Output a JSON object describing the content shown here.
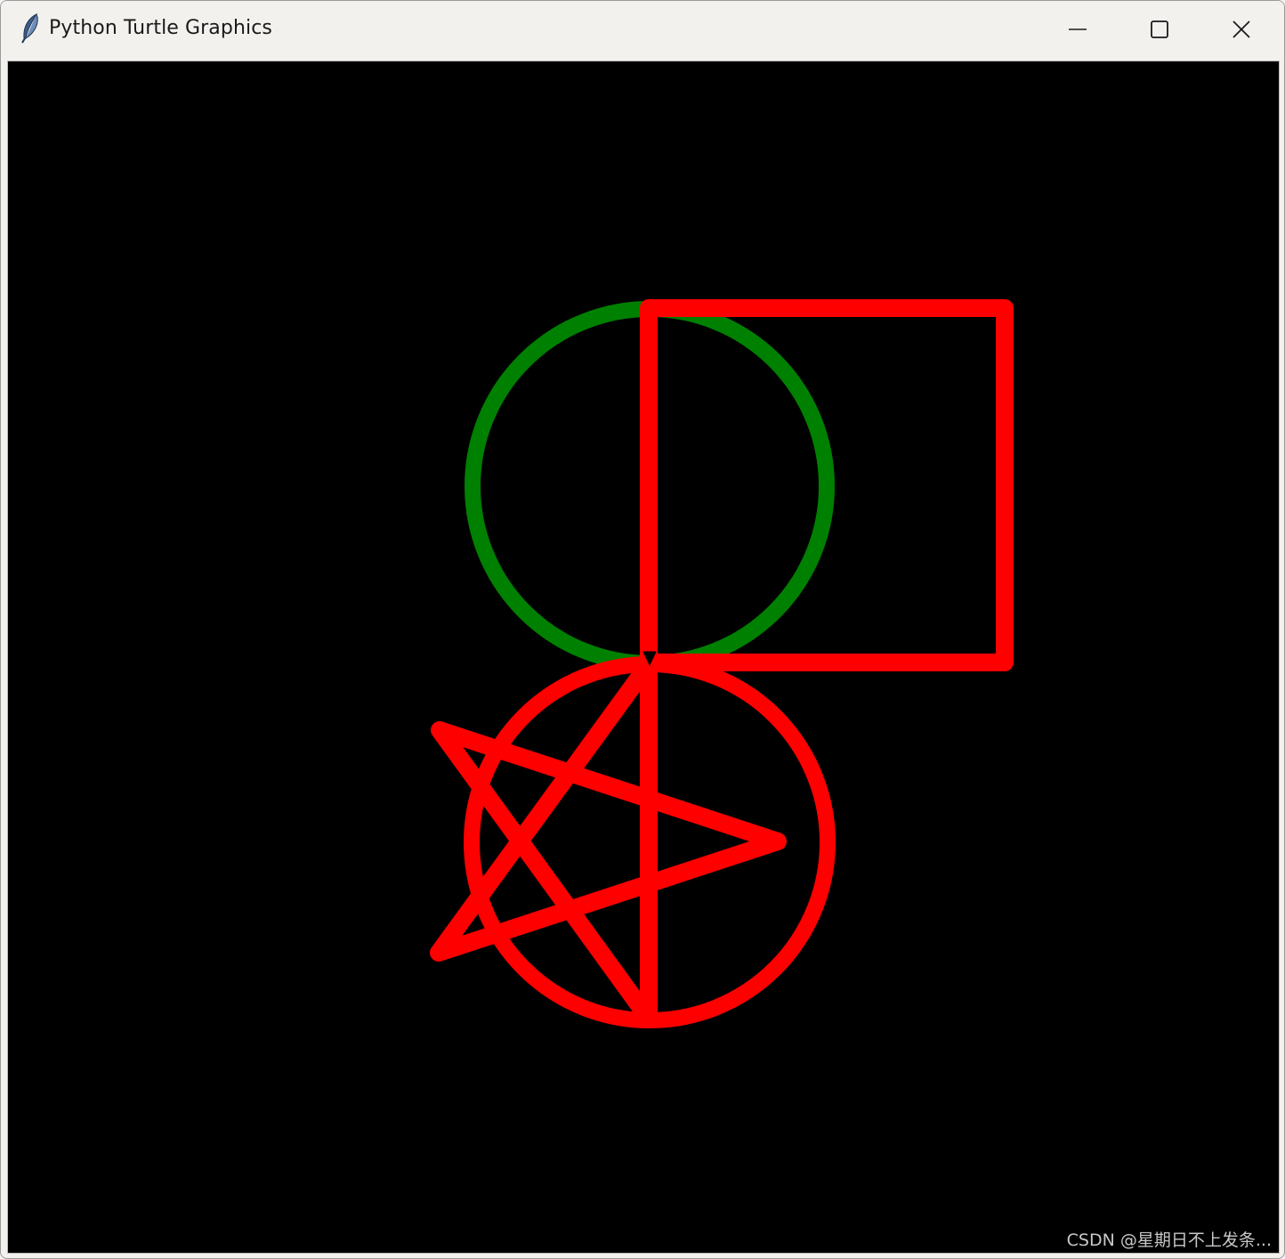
{
  "window": {
    "title": "Python Turtle Graphics",
    "app_icon": "feather-icon"
  },
  "controls": {
    "minimize_icon": "minimize-icon",
    "maximize_icon": "maximize-icon",
    "close_icon": "close-icon"
  },
  "canvas": {
    "background_color": "#000000",
    "shapes": [
      {
        "type": "circle",
        "color": "#008000",
        "description": "green circle"
      },
      {
        "type": "square",
        "color": "#ff0000",
        "description": "red square"
      },
      {
        "type": "circle",
        "color": "#ff0000",
        "description": "red circle"
      },
      {
        "type": "star",
        "color": "#ff0000",
        "description": "red five-pointed star"
      }
    ],
    "turtle_cursor": "arrow"
  },
  "watermark": "CSDN @星期日不上发条..."
}
